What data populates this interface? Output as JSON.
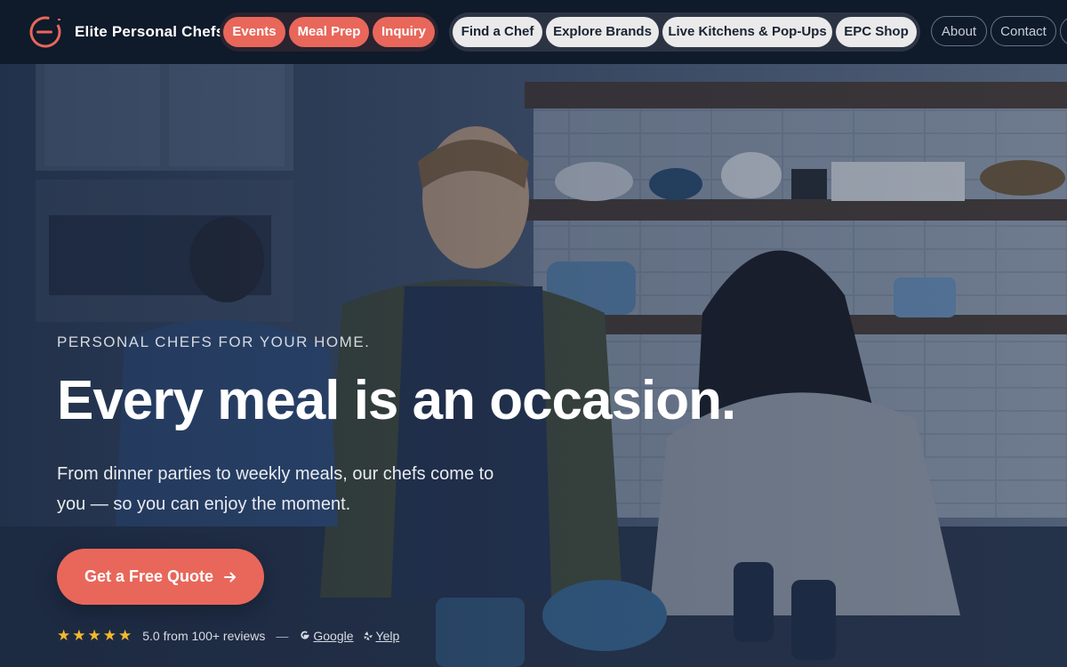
{
  "brand": {
    "name": "Elite Personal Chefs"
  },
  "nav": {
    "primary": [
      {
        "label": "Events"
      },
      {
        "label": "Meal Prep"
      },
      {
        "label": "Inquiry"
      }
    ],
    "secondary": [
      {
        "label": "Find a Chef"
      },
      {
        "label": "Explore Brands"
      },
      {
        "label": "Live Kitchens & Pop-Ups"
      },
      {
        "label": "EPC Shop"
      }
    ],
    "utility": [
      {
        "label": "About"
      },
      {
        "label": "Contact"
      }
    ]
  },
  "hero": {
    "eyebrow": "PERSONAL CHEFS FOR YOUR HOME.",
    "headline": "Every meal is an occasion.",
    "subtext": "From dinner parties to weekly meals, our chefs come to you — so you can enjoy the moment.",
    "cta_label": "Get a Free Quote",
    "rating_stars": 5,
    "review_text": "5.0 from 100+ reviews",
    "review_separator": "—",
    "review_sources": [
      {
        "label": "Google",
        "icon": "google-icon"
      },
      {
        "label": "Yelp",
        "icon": "yelp-icon"
      }
    ]
  },
  "colors": {
    "accent": "#e8675a",
    "nav_bg": "#0f1a2b",
    "star": "#f5b82e"
  }
}
